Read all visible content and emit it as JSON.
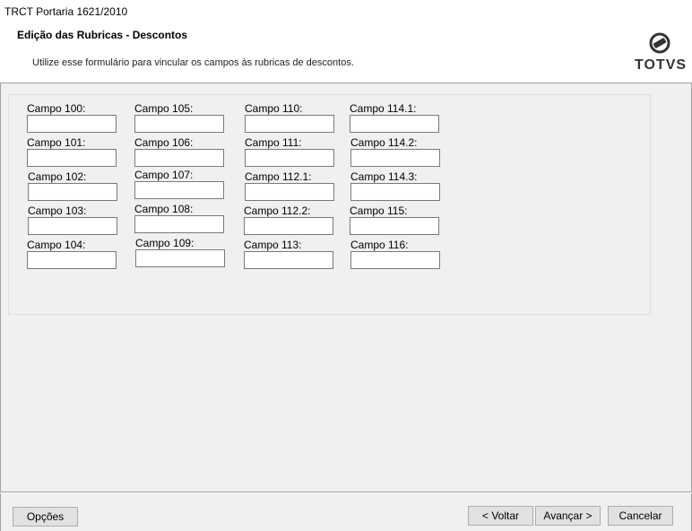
{
  "window": {
    "title": "TRCT Portaria 1621/2010"
  },
  "header": {
    "title": "Edição das Rubricas - Descontos",
    "subtitle": "Utilize esse formulário para vincular os campos às rubricas de descontos.",
    "logo_text": "TOTVS"
  },
  "fields": [
    {
      "label": "Campo 100:",
      "value": ""
    },
    {
      "label": "Campo 101:",
      "value": ""
    },
    {
      "label": "Campo 102:",
      "value": ""
    },
    {
      "label": "Campo 103:",
      "value": ""
    },
    {
      "label": "Campo 104:",
      "value": ""
    },
    {
      "label": "Campo 105:",
      "value": ""
    },
    {
      "label": "Campo 106:",
      "value": ""
    },
    {
      "label": "Campo 107:",
      "value": ""
    },
    {
      "label": "Campo 108:",
      "value": ""
    },
    {
      "label": "Campo 109:",
      "value": ""
    },
    {
      "label": "Campo 110:",
      "value": ""
    },
    {
      "label": "Campo 111:",
      "value": ""
    },
    {
      "label": "Campo 112.1:",
      "value": ""
    },
    {
      "label": "Campo 112.2:",
      "value": ""
    },
    {
      "label": "Campo 113:",
      "value": ""
    },
    {
      "label": "Campo 114.1:",
      "value": ""
    },
    {
      "label": "Campo 114.2:",
      "value": ""
    },
    {
      "label": "Campo 114.3:",
      "value": ""
    },
    {
      "label": "Campo 115:",
      "value": ""
    },
    {
      "label": "Campo 116:",
      "value": ""
    }
  ],
  "footer": {
    "options_label": "Opções",
    "back_label": "< Voltar",
    "next_label": "Avançar >",
    "cancel_label": "Cancelar"
  }
}
